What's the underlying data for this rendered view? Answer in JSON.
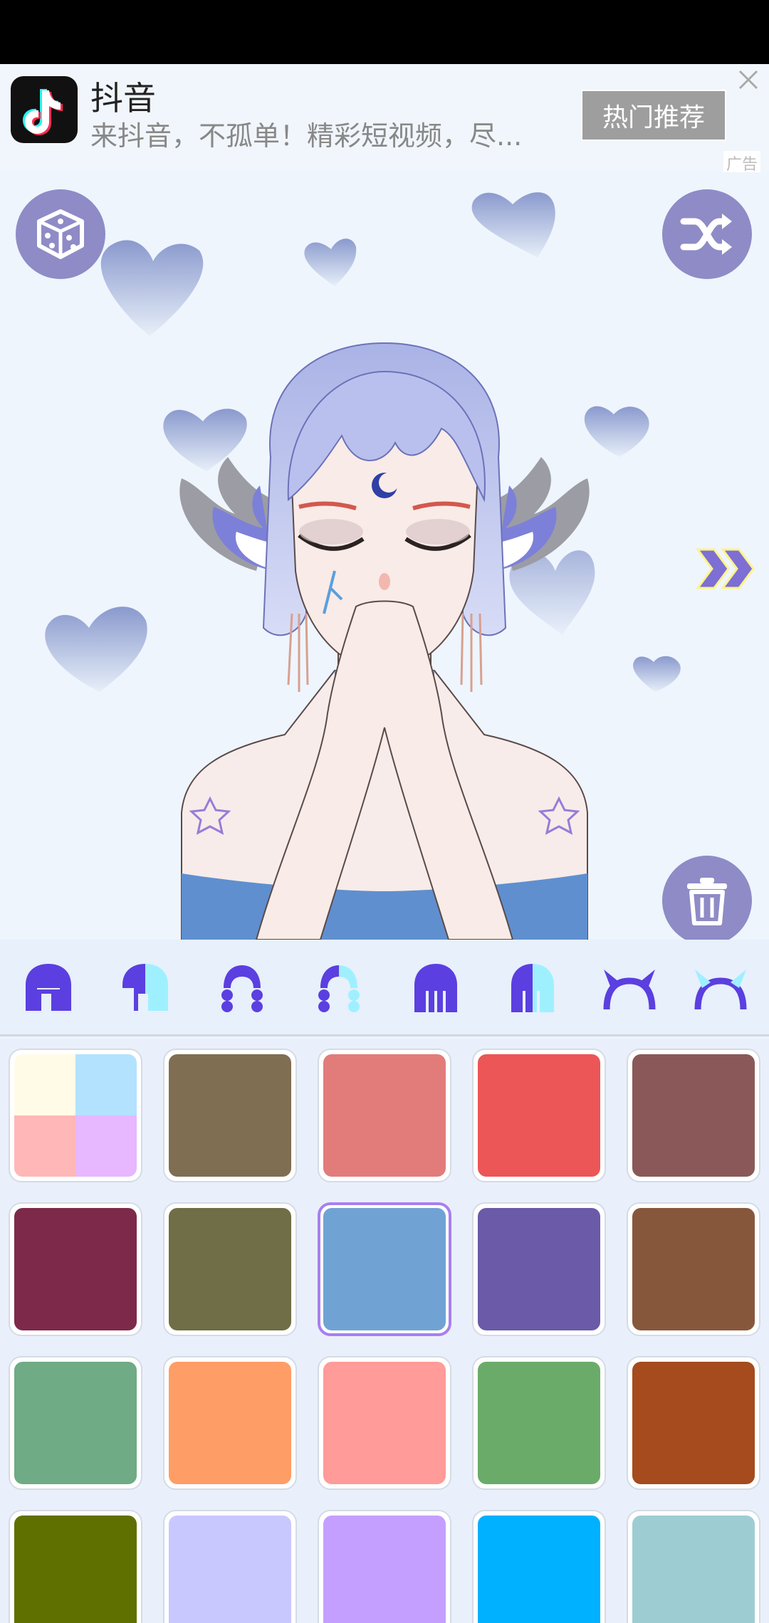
{
  "ad": {
    "app_name": "抖音",
    "description": "来抖音，不孤单！精彩短视频，尽...",
    "button_label": "热门推荐",
    "tag": "广告"
  },
  "toolbar": {
    "dice_icon": "dice-icon",
    "shuffle_icon": "shuffle-icon",
    "next_icon": "double-chevron-right-icon",
    "delete_icon": "trash-icon"
  },
  "parts": [
    {
      "name": "short-hair-dark",
      "color": "#5b3fe0"
    },
    {
      "name": "short-hair-light",
      "color": "#9ff0ff"
    },
    {
      "name": "braided-hair-dark",
      "color": "#5b3fe0"
    },
    {
      "name": "braided-hair-light",
      "color": "#9ff0ff"
    },
    {
      "name": "long-hair-dark",
      "color": "#5b3fe0"
    },
    {
      "name": "long-hair-light",
      "color": "#9ff0ff"
    },
    {
      "name": "horns-dark",
      "color": "#5b3fe0"
    },
    {
      "name": "horns-light",
      "color": "#9ff0ff"
    }
  ],
  "palette": {
    "selected_color": "#70a3d4",
    "colors": [
      "multi",
      "#806e53",
      "#e27c7a",
      "#ec5656",
      "#8a5858",
      "#7d2a4a",
      "#6f6e46",
      "#70a3d4",
      "#6a5aa8",
      "#87573c",
      "#6fab84",
      "#ff9d67",
      "#ff9b98",
      "#6aab6a",
      "#a54b1d",
      "#5f7000",
      "#c8c8ff",
      "#c59fff",
      "#00b1ff",
      "#9dcdd3"
    ],
    "multi_colors": [
      "#fffbe6",
      "#b3e2ff",
      "#ffb7b7",
      "#e7b7ff"
    ]
  }
}
